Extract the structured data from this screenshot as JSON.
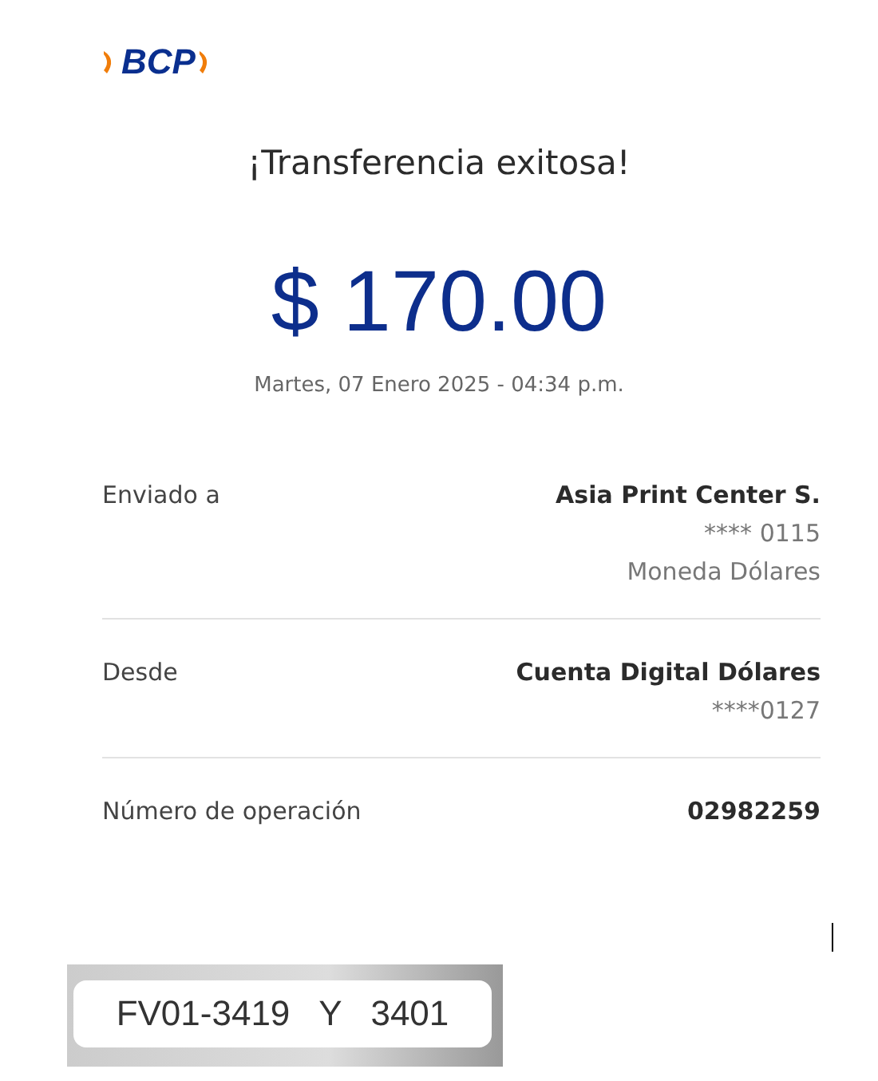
{
  "logo": {
    "text": "BCP"
  },
  "title": "¡Transferencia exitosa!",
  "amount": "$ 170.00",
  "datetime": "Martes, 07 Enero 2025 - 04:34 p.m.",
  "details": [
    {
      "label": "Enviado a",
      "lines": [
        {
          "text": "Asia Print Center S.",
          "bold": true
        },
        {
          "text": "**** 0115",
          "bold": false
        },
        {
          "text": "Moneda Dólares",
          "bold": false
        }
      ]
    },
    {
      "label": "Desde",
      "lines": [
        {
          "text": "Cuenta Digital Dólares",
          "bold": true
        },
        {
          "text": "****0127",
          "bold": false
        }
      ]
    },
    {
      "label": "Número de operación",
      "lines": [
        {
          "text": "02982259",
          "bold": true
        }
      ]
    }
  ],
  "sticker": {
    "text": "FV01-3419   Y   3401"
  }
}
